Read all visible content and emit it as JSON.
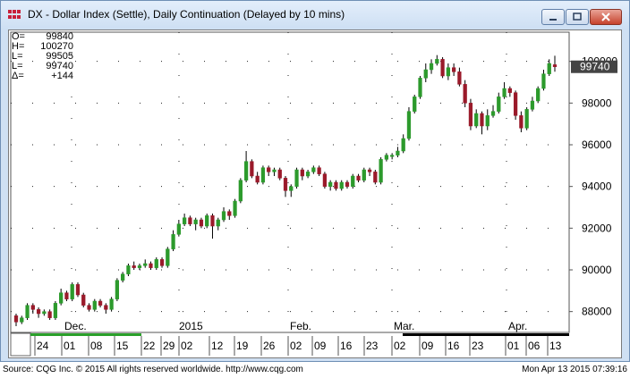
{
  "window": {
    "title": "DX - Dollar Index (Settle), Daily Continuation (Delayed by 10 mins)",
    "buttons": [
      "minimize",
      "maximize",
      "close"
    ]
  },
  "readout": [
    {
      "label": "O=",
      "value": "99840"
    },
    {
      "label": "H=",
      "value": "100270"
    },
    {
      "label": "L=",
      "value": "99505"
    },
    {
      "label": "L=",
      "value": "99740"
    },
    {
      "label": "Δ=",
      "value": "+144"
    }
  ],
  "last_price_tag": "99740",
  "footer": {
    "source": "Source: CQG Inc. © 2015 All rights reserved worldwide. http://www.cqg.com",
    "timestamp": "Mon Apr 13 2015 07:39:16"
  },
  "colors": {
    "up": "#2c9a2c",
    "down": "#9a1a2a",
    "grid": "#222222",
    "price_tag_bg": "#444444",
    "price_tag_text": "#ffffff"
  },
  "chart_data": {
    "type": "candlestick",
    "y_ticks": [
      "88000",
      "90000",
      "92000",
      "94000",
      "96000",
      "98000",
      "100000"
    ],
    "ylim": [
      87000,
      101400
    ],
    "month_labels": [
      "Dec.",
      "2015",
      "Feb.",
      "Mar.",
      "Apr."
    ],
    "day_labels": [
      "24",
      "01",
      "08",
      "15",
      "22",
      "29",
      "02",
      "12",
      "19",
      "26",
      "02",
      "09",
      "16",
      "23",
      "02",
      "09",
      "16",
      "23",
      "01",
      "06",
      "13"
    ],
    "grid": "dotted",
    "candles": [
      {
        "o": 87800,
        "c": 87500,
        "h": 87900,
        "l": 87300
      },
      {
        "o": 87500,
        "c": 87700,
        "h": 87800,
        "l": 87400
      },
      {
        "o": 87700,
        "c": 88300,
        "h": 88400,
        "l": 87600
      },
      {
        "o": 88300,
        "c": 88100,
        "h": 88400,
        "l": 87900
      },
      {
        "o": 88100,
        "c": 87900,
        "h": 88200,
        "l": 87700
      },
      {
        "o": 87900,
        "c": 88000,
        "h": 88100,
        "l": 87800
      },
      {
        "o": 88000,
        "c": 87700,
        "h": 88100,
        "l": 87600
      },
      {
        "o": 87700,
        "c": 88400,
        "h": 88500,
        "l": 87600
      },
      {
        "o": 88400,
        "c": 88900,
        "h": 89100,
        "l": 88300
      },
      {
        "o": 88900,
        "c": 88600,
        "h": 89000,
        "l": 88500
      },
      {
        "o": 88600,
        "c": 89300,
        "h": 89400,
        "l": 88500
      },
      {
        "o": 89300,
        "c": 88800,
        "h": 89400,
        "l": 88700
      },
      {
        "o": 88800,
        "c": 88300,
        "h": 88900,
        "l": 88200
      },
      {
        "o": 88300,
        "c": 88100,
        "h": 88400,
        "l": 88000
      },
      {
        "o": 88100,
        "c": 88500,
        "h": 88600,
        "l": 88000
      },
      {
        "o": 88500,
        "c": 88300,
        "h": 88600,
        "l": 88200
      },
      {
        "o": 88300,
        "c": 88100,
        "h": 88400,
        "l": 87900
      },
      {
        "o": 88100,
        "c": 88600,
        "h": 88700,
        "l": 88000
      },
      {
        "o": 88600,
        "c": 89500,
        "h": 89600,
        "l": 88500
      },
      {
        "o": 89500,
        "c": 89800,
        "h": 89900,
        "l": 89400
      },
      {
        "o": 89800,
        "c": 90200,
        "h": 90300,
        "l": 89700
      },
      {
        "o": 90200,
        "c": 90100,
        "h": 90400,
        "l": 90000
      },
      {
        "o": 90100,
        "c": 90200,
        "h": 90300,
        "l": 90000
      },
      {
        "o": 90200,
        "c": 90300,
        "h": 90500,
        "l": 90100
      },
      {
        "o": 90300,
        "c": 90100,
        "h": 90400,
        "l": 90000
      },
      {
        "o": 90100,
        "c": 90500,
        "h": 90600,
        "l": 90000
      },
      {
        "o": 90500,
        "c": 90200,
        "h": 90600,
        "l": 90100
      },
      {
        "o": 90200,
        "c": 91000,
        "h": 91100,
        "l": 90100
      },
      {
        "o": 91000,
        "c": 91700,
        "h": 91900,
        "l": 90900
      },
      {
        "o": 91700,
        "c": 92200,
        "h": 92400,
        "l": 91600
      },
      {
        "o": 92200,
        "c": 92500,
        "h": 92700,
        "l": 92100
      },
      {
        "o": 92500,
        "c": 92200,
        "h": 92600,
        "l": 92100
      },
      {
        "o": 92200,
        "c": 92400,
        "h": 92500,
        "l": 91900
      },
      {
        "o": 92400,
        "c": 92100,
        "h": 92500,
        "l": 92000
      },
      {
        "o": 92100,
        "c": 92600,
        "h": 92700,
        "l": 92000
      },
      {
        "o": 92600,
        "c": 92100,
        "h": 92700,
        "l": 91500
      },
      {
        "o": 92100,
        "c": 92400,
        "h": 92500,
        "l": 91900
      },
      {
        "o": 92400,
        "c": 92800,
        "h": 93000,
        "l": 92300
      },
      {
        "o": 92800,
        "c": 92600,
        "h": 92900,
        "l": 92400
      },
      {
        "o": 92600,
        "c": 93300,
        "h": 93400,
        "l": 92500
      },
      {
        "o": 93300,
        "c": 94300,
        "h": 94400,
        "l": 93200
      },
      {
        "o": 94300,
        "c": 95200,
        "h": 95700,
        "l": 94200
      },
      {
        "o": 95200,
        "c": 94500,
        "h": 95300,
        "l": 94400
      },
      {
        "o": 94500,
        "c": 94200,
        "h": 94700,
        "l": 94100
      },
      {
        "o": 94200,
        "c": 94900,
        "h": 95000,
        "l": 94100
      },
      {
        "o": 94900,
        "c": 94700,
        "h": 95000,
        "l": 94500
      },
      {
        "o": 94700,
        "c": 94800,
        "h": 94900,
        "l": 94500
      },
      {
        "o": 94800,
        "c": 94400,
        "h": 94900,
        "l": 94300
      },
      {
        "o": 94400,
        "c": 93800,
        "h": 94500,
        "l": 93500
      },
      {
        "o": 93800,
        "c": 94000,
        "h": 94100,
        "l": 93500
      },
      {
        "o": 94000,
        "c": 94800,
        "h": 94900,
        "l": 93900
      },
      {
        "o": 94800,
        "c": 94500,
        "h": 94900,
        "l": 94300
      },
      {
        "o": 94500,
        "c": 94700,
        "h": 94800,
        "l": 94400
      },
      {
        "o": 94700,
        "c": 94900,
        "h": 95000,
        "l": 94600
      },
      {
        "o": 94900,
        "c": 94600,
        "h": 95000,
        "l": 94500
      },
      {
        "o": 94600,
        "c": 94000,
        "h": 94700,
        "l": 93900
      },
      {
        "o": 94000,
        "c": 94200,
        "h": 94300,
        "l": 93800
      },
      {
        "o": 94200,
        "c": 93900,
        "h": 94300,
        "l": 93800
      },
      {
        "o": 93900,
        "c": 94200,
        "h": 94300,
        "l": 93800
      },
      {
        "o": 94200,
        "c": 94000,
        "h": 94300,
        "l": 93900
      },
      {
        "o": 94000,
        "c": 94500,
        "h": 94600,
        "l": 93900
      },
      {
        "o": 94500,
        "c": 94300,
        "h": 94600,
        "l": 94200
      },
      {
        "o": 94300,
        "c": 94800,
        "h": 94900,
        "l": 94200
      },
      {
        "o": 94800,
        "c": 94700,
        "h": 94900,
        "l": 94500
      },
      {
        "o": 94700,
        "c": 94200,
        "h": 94800,
        "l": 94100
      },
      {
        "o": 94200,
        "c": 95300,
        "h": 95400,
        "l": 94100
      },
      {
        "o": 95300,
        "c": 95500,
        "h": 95600,
        "l": 95200
      },
      {
        "o": 95500,
        "c": 95500,
        "h": 95600,
        "l": 95300
      },
      {
        "o": 95500,
        "c": 95700,
        "h": 95900,
        "l": 95400
      },
      {
        "o": 95700,
        "c": 96300,
        "h": 96500,
        "l": 95600
      },
      {
        "o": 96300,
        "c": 97600,
        "h": 97800,
        "l": 96200
      },
      {
        "o": 97600,
        "c": 98300,
        "h": 98400,
        "l": 97500
      },
      {
        "o": 98300,
        "c": 99200,
        "h": 99300,
        "l": 98200
      },
      {
        "o": 99200,
        "c": 99600,
        "h": 99900,
        "l": 99000
      },
      {
        "o": 99600,
        "c": 99900,
        "h": 100100,
        "l": 99400
      },
      {
        "o": 99900,
        "c": 100100,
        "h": 100300,
        "l": 99800
      },
      {
        "o": 100100,
        "c": 99300,
        "h": 100200,
        "l": 99200
      },
      {
        "o": 99300,
        "c": 99700,
        "h": 99900,
        "l": 99100
      },
      {
        "o": 99700,
        "c": 99500,
        "h": 99900,
        "l": 99300
      },
      {
        "o": 99500,
        "c": 98900,
        "h": 99700,
        "l": 98800
      },
      {
        "o": 98900,
        "c": 98000,
        "h": 99100,
        "l": 97800
      },
      {
        "o": 98000,
        "c": 96900,
        "h": 98200,
        "l": 96700
      },
      {
        "o": 96900,
        "c": 97500,
        "h": 97700,
        "l": 96800
      },
      {
        "o": 97500,
        "c": 96900,
        "h": 97600,
        "l": 96500
      },
      {
        "o": 96900,
        "c": 97400,
        "h": 97700,
        "l": 96700
      },
      {
        "o": 97400,
        "c": 97600,
        "h": 97900,
        "l": 97300
      },
      {
        "o": 97600,
        "c": 98300,
        "h": 98500,
        "l": 97500
      },
      {
        "o": 98300,
        "c": 98700,
        "h": 99000,
        "l": 98200
      },
      {
        "o": 98700,
        "c": 98500,
        "h": 98800,
        "l": 98300
      },
      {
        "o": 98500,
        "c": 97400,
        "h": 98600,
        "l": 97200
      },
      {
        "o": 97400,
        "c": 96800,
        "h": 97600,
        "l": 96600
      },
      {
        "o": 96800,
        "c": 97700,
        "h": 97800,
        "l": 96700
      },
      {
        "o": 97700,
        "c": 98100,
        "h": 98300,
        "l": 97600
      },
      {
        "o": 98100,
        "c": 98700,
        "h": 98800,
        "l": 98000
      },
      {
        "o": 98700,
        "c": 99400,
        "h": 99600,
        "l": 98600
      },
      {
        "o": 99400,
        "c": 99900,
        "h": 100100,
        "l": 99300
      },
      {
        "o": 99840,
        "c": 99740,
        "h": 100270,
        "l": 99505
      }
    ]
  }
}
